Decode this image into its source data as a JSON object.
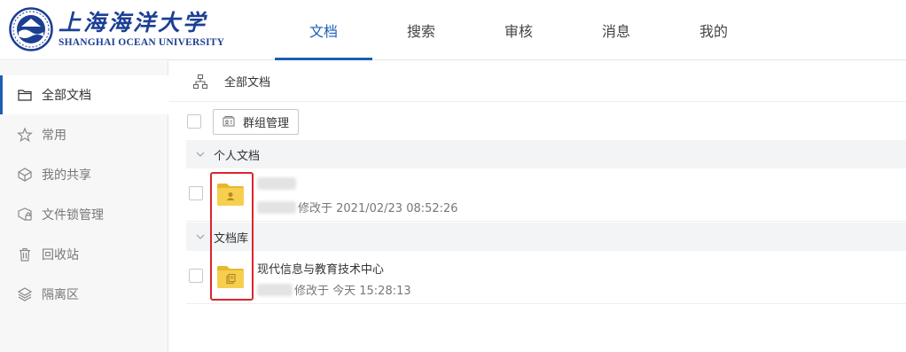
{
  "logo": {
    "name_cn": "上海海洋大学",
    "name_en": "SHANGHAI OCEAN UNIVERSITY"
  },
  "nav": {
    "items": [
      {
        "label": "文档",
        "active": true
      },
      {
        "label": "搜索",
        "active": false
      },
      {
        "label": "审核",
        "active": false
      },
      {
        "label": "消息",
        "active": false
      },
      {
        "label": "我的",
        "active": false
      }
    ]
  },
  "sidebar": {
    "items": [
      {
        "label": "全部文档",
        "icon": "folder-outline-icon",
        "active": true
      },
      {
        "label": "常用",
        "icon": "star-icon",
        "active": false
      },
      {
        "label": "我的共享",
        "icon": "share-icon",
        "active": false
      },
      {
        "label": "文件锁管理",
        "icon": "file-lock-icon",
        "active": false
      },
      {
        "label": "回收站",
        "icon": "trash-icon",
        "active": false
      },
      {
        "label": "隔离区",
        "icon": "layers-icon",
        "active": false
      }
    ]
  },
  "breadcrumb": {
    "icon": "hierarchy-icon",
    "label": "全部文档"
  },
  "toolbar": {
    "group_button_label": "群组管理",
    "group_button_icon": "group-card-icon"
  },
  "sections": [
    {
      "title": "个人文档",
      "items": [
        {
          "name": "",
          "name_redacted": true,
          "modified_label": "修改于 2021/02/23 08:52:26",
          "icon": "personal-folder-icon"
        }
      ]
    },
    {
      "title": "文档库",
      "items": [
        {
          "name": "现代信息与教育技术中心",
          "name_redacted": false,
          "modified_label": "修改于 今天 15:28:13",
          "icon": "library-folder-icon"
        }
      ]
    }
  ],
  "colors": {
    "accent": "#1a5fb4",
    "logo": "#1c3f94",
    "folder": "#f5c745",
    "highlight": "#d9262b"
  }
}
